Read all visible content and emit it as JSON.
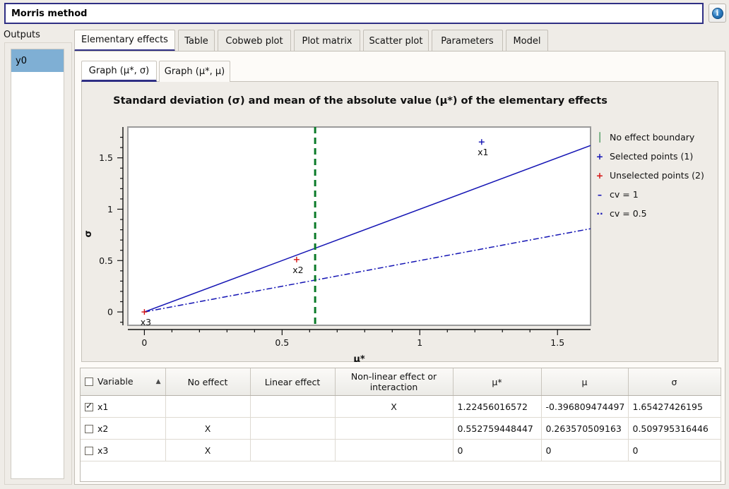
{
  "window": {
    "title": "Morris method",
    "info_icon": "info-icon",
    "info_glyph": "i"
  },
  "sidebar": {
    "label": "Outputs",
    "items": [
      {
        "label": "y0",
        "selected": true
      }
    ]
  },
  "tabs": [
    {
      "label": "Elementary effects",
      "active": true
    },
    {
      "label": "Table",
      "active": false
    },
    {
      "label": "Cobweb plot",
      "active": false
    },
    {
      "label": "Plot matrix",
      "active": false
    },
    {
      "label": "Scatter plot",
      "active": false
    },
    {
      "label": "Parameters",
      "active": false
    },
    {
      "label": "Model",
      "active": false
    }
  ],
  "subtabs": [
    {
      "label": "Graph (μ*, σ)",
      "active": true
    },
    {
      "label": "Graph (μ*, μ)",
      "active": false
    }
  ],
  "legend": [
    {
      "mark": "│",
      "color": "#0a7a28",
      "label": "No effect boundary",
      "name": "legend-no-effect-boundary"
    },
    {
      "mark": "+",
      "color": "#1414b4",
      "label": "Selected points (1)",
      "name": "legend-selected-points"
    },
    {
      "mark": "+",
      "color": "#d41414",
      "label": "Unselected points (2)",
      "name": "legend-unselected-points"
    },
    {
      "mark": "–",
      "color": "#1414b4",
      "label": "cv = 1",
      "name": "legend-cv-1"
    },
    {
      "mark": "··",
      "color": "#1414b4",
      "label": "cv = 0.5",
      "name": "legend-cv-05"
    }
  ],
  "chart_data": {
    "type": "scatter",
    "title": "Standard deviation (σ) and mean of the absolute value (μ*) of the elementary effects",
    "xlabel": "μ*",
    "ylabel": "σ",
    "xlim": [
      -0.06,
      1.62
    ],
    "ylim": [
      -0.13,
      1.8
    ],
    "xticks": [
      0,
      0.5,
      1,
      1.5
    ],
    "xticklabels": [
      "0",
      "0.5",
      "1",
      "1.5"
    ],
    "yticks": [
      0,
      0.5,
      1,
      1.5
    ],
    "yticklabels": [
      "0",
      "0.5",
      "1",
      "1.5"
    ],
    "grid": false,
    "legend_position": "right",
    "points": [
      {
        "label": "x1",
        "mu_star": 1.22456016572,
        "sigma": 1.65427426195,
        "selected": true,
        "color": "#1414b4"
      },
      {
        "label": "x2",
        "mu_star": 0.552759448447,
        "sigma": 0.509795316446,
        "selected": false,
        "color": "#d41414"
      },
      {
        "label": "x3",
        "mu_star": 0,
        "sigma": 0,
        "selected": false,
        "color": "#d41414"
      }
    ],
    "lines": [
      {
        "name": "cv = 1",
        "slope": 1.0,
        "style": "solid",
        "color": "#1414b4"
      },
      {
        "name": "cv = 0.5",
        "slope": 0.5,
        "style": "dashdot",
        "color": "#1414b4"
      }
    ],
    "boundary": {
      "name": "No effect boundary",
      "x": 0.62,
      "style": "dashed",
      "color": "#0a7a28"
    }
  },
  "table": {
    "columns": [
      {
        "label": "Variable",
        "name": "col-variable",
        "sorted": "asc",
        "has_checkbox": true
      },
      {
        "label": "No effect",
        "name": "col-no-effect"
      },
      {
        "label": "Linear effect",
        "name": "col-linear-effect"
      },
      {
        "label": "Non-linear effect or interaction",
        "name": "col-nonlinear-effect"
      },
      {
        "label": "μ*",
        "name": "col-mu-star"
      },
      {
        "label": "μ",
        "name": "col-mu"
      },
      {
        "label": "σ",
        "name": "col-sigma"
      }
    ],
    "sort_arrow": "▲",
    "rows": [
      {
        "checked": true,
        "variable": "x1",
        "no_effect": "",
        "linear_effect": "",
        "nonlinear_effect": "X",
        "mu_star": "1.22456016572",
        "mu": "-0.396809474497",
        "sigma": "1.65427426195"
      },
      {
        "checked": false,
        "variable": "x2",
        "no_effect": "X",
        "linear_effect": "",
        "nonlinear_effect": "",
        "mu_star": "0.552759448447",
        "mu": "0.263570509163",
        "sigma": "0.509795316446"
      },
      {
        "checked": false,
        "variable": "x3",
        "no_effect": "X",
        "linear_effect": "",
        "nonlinear_effect": "",
        "mu_star": "0",
        "mu": "0",
        "sigma": "0"
      }
    ]
  }
}
